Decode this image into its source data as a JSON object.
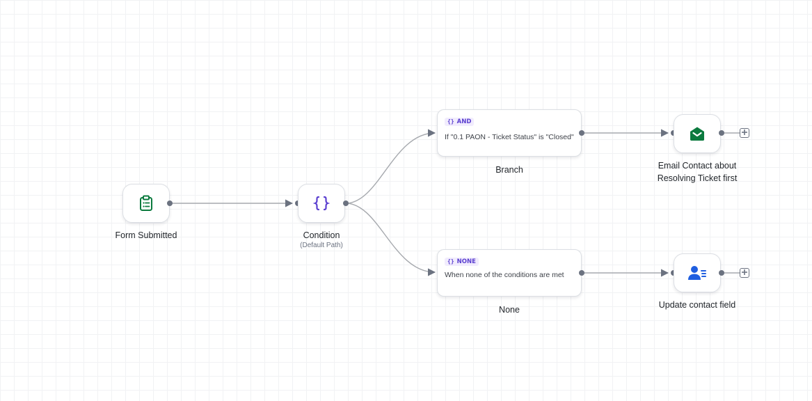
{
  "nodes": {
    "form_submitted": {
      "label": "Form Submitted",
      "icon": "clipboard-icon",
      "icon_color": "#0b7a3e"
    },
    "condition": {
      "label": "Condition",
      "sublabel": "(Default Path)",
      "icon": "braces-icon",
      "icon_color": "#5b3fd0"
    },
    "email_contact": {
      "label_line1": "Email Contact about",
      "label_line2": "Resolving Ticket first",
      "icon": "envelope-open-icon",
      "icon_color": "#0b7a3e"
    },
    "update_contact": {
      "label": "Update contact field",
      "icon": "user-list-icon",
      "icon_color": "#1f5ee0"
    }
  },
  "branches": [
    {
      "badge": "AND",
      "badge_icon": "{}",
      "text": "If \"0.1 PAON - Ticket Status\" is \"Closed\"",
      "label": "Branch"
    },
    {
      "badge": "NONE",
      "badge_icon": "{}",
      "text": "When none of the conditions are met",
      "label": "None"
    }
  ],
  "colors": {
    "edge": "#a6a9ae",
    "port": "#6b7280",
    "accent_purple": "#5b3fd0",
    "accent_green": "#0b7a3e",
    "accent_blue": "#1f5ee0"
  }
}
